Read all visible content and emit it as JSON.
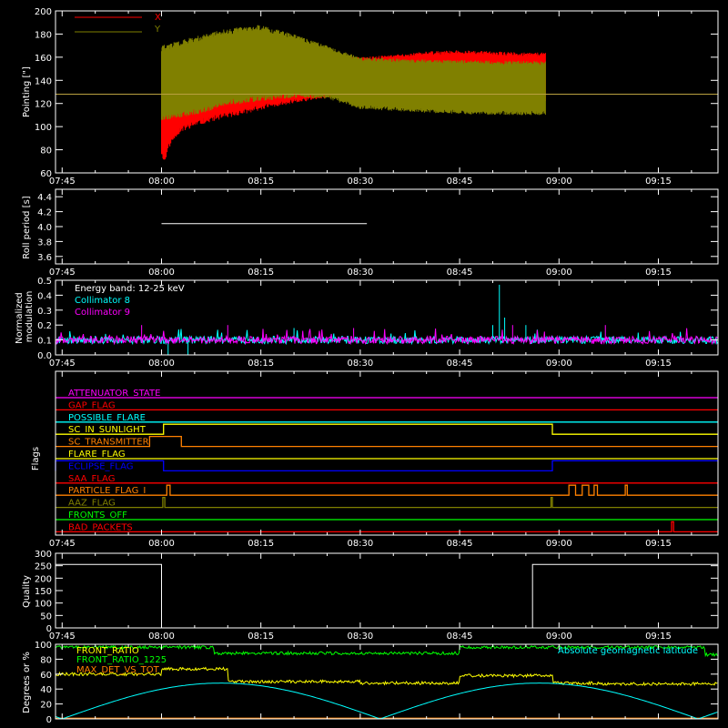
{
  "chart_data": [
    {
      "type": "line",
      "ylabel": "Pointing [\"]",
      "ylim": [
        60,
        200
      ],
      "yticks": [
        60,
        80,
        100,
        120,
        140,
        160,
        180,
        200
      ],
      "xticks": [
        "07:45",
        "08:00",
        "08:15",
        "08:30",
        "08:45",
        "09:00",
        "09:15"
      ],
      "legend_position": "top-left",
      "series": [
        {
          "name": "X",
          "color": "#ff0000",
          "x_min": [
            0,
            0.5,
            1,
            2,
            3,
            5,
            8,
            12,
            16,
            20,
            25,
            30,
            35,
            40,
            45,
            50,
            55,
            58
          ],
          "y_min": [
            75,
            68,
            80,
            90,
            95,
            100,
            105,
            110,
            116,
            120,
            125,
            125,
            124,
            124,
            123,
            123,
            122,
            122
          ],
          "x_max": [
            0,
            2,
            5,
            10,
            15,
            20,
            25,
            30,
            35,
            40,
            45,
            50,
            55,
            58
          ],
          "y_max": [
            150,
            155,
            165,
            170,
            170,
            165,
            162,
            160,
            162,
            165,
            166,
            165,
            164,
            164
          ]
        },
        {
          "name": "Y",
          "color": "#808000",
          "x_min": [
            0,
            5,
            10,
            15,
            20,
            25,
            30,
            40,
            50,
            58
          ],
          "y_min": [
            105,
            110,
            118,
            122,
            125,
            124,
            115,
            112,
            110,
            110
          ],
          "x_max": [
            0,
            5,
            10,
            15,
            20,
            25,
            30,
            40,
            50,
            58
          ],
          "y_max": [
            170,
            178,
            185,
            188,
            180,
            170,
            160,
            158,
            157,
            157
          ]
        }
      ],
      "reference_line": {
        "y": 128,
        "color": "#b8a040"
      }
    },
    {
      "type": "line",
      "ylabel": "Roll period [s]",
      "ylim": [
        3.5,
        4.5
      ],
      "yticks": [
        3.6,
        3.8,
        4.0,
        4.2,
        4.4
      ],
      "xticks": [
        "07:45",
        "08:00",
        "08:15",
        "08:30",
        "08:45",
        "09:00",
        "09:15"
      ],
      "series": [
        {
          "x": [
            0,
            31
          ],
          "y": [
            4.04,
            4.04
          ],
          "color": "#ffffff"
        }
      ]
    },
    {
      "type": "line",
      "ylabel": "Normalized modulation",
      "ylim": [
        0,
        0.5
      ],
      "yticks": [
        0.0,
        0.1,
        0.2,
        0.3,
        0.4,
        0.5
      ],
      "xticks": [
        "07:45",
        "08:00",
        "08:15",
        "08:30",
        "08:45",
        "09:00",
        "09:15"
      ],
      "annotation": "Energy band: 12-25 keV",
      "series": [
        {
          "name": "Collimator 8",
          "color": "#00ffff",
          "baseline": 0.1,
          "spikes": [
            {
              "x": 51,
              "y": 0.47
            },
            {
              "x": 51.8,
              "y": 0.25
            },
            {
              "x": 50,
              "y": 0.2
            },
            {
              "x": 20,
              "y": 0.18
            },
            {
              "x": 55,
              "y": 0.2
            }
          ],
          "dips": [
            {
              "x": 1,
              "y": 0.0
            },
            {
              "x": 4,
              "y": 0.0
            }
          ]
        },
        {
          "name": "Collimator 9",
          "color": "#ff00ff",
          "baseline": 0.1,
          "spikes": [
            {
              "x": -3,
              "y": 0.2
            },
            {
              "x": 10,
              "y": 0.2
            },
            {
              "x": 29,
              "y": 0.18
            },
            {
              "x": 53,
              "y": 0.2
            },
            {
              "x": 67,
              "y": 0.2
            }
          ]
        }
      ]
    },
    {
      "type": "line",
      "ylabel": "Flags",
      "xticks": [
        "07:45",
        "08:00",
        "08:15",
        "08:30",
        "08:45",
        "09:00",
        "09:15"
      ],
      "series": [
        {
          "name": "ATTENUATOR_STATE",
          "color": "#ff00ff",
          "high": []
        },
        {
          "name": "GAP_FLAG",
          "color": "#ff0000",
          "high": []
        },
        {
          "name": "POSSIBLE_FLARE",
          "color": "#00ffff",
          "high": []
        },
        {
          "name": "SC_IN_SUNLIGHT",
          "color": "#ffff00",
          "high": [
            [
              0.3,
              59
            ]
          ]
        },
        {
          "name": "SC_TRANSMITTER",
          "color": "#ff8000",
          "high": [
            [
              -1.8,
              3
            ]
          ]
        },
        {
          "name": "FLARE_FLAG",
          "color": "#ffff00",
          "high": []
        },
        {
          "name": "ECLIPSE_FLAG",
          "color": "#0000ff",
          "high": [
            [
              -99,
              0.3
            ],
            [
              59,
              99
            ]
          ]
        },
        {
          "name": "SAA_FLAG",
          "color": "#ff0000",
          "high": []
        },
        {
          "name": "PARTICLE_FLAG_I",
          "color": "#ff8000",
          "high": [
            [
              0.8,
              1.3
            ],
            [
              61.5,
              62.5
            ],
            [
              63.5,
              64.5
            ],
            [
              65.3,
              65.8
            ],
            [
              70,
              70.3
            ]
          ]
        },
        {
          "name": "AAZ_FLAG",
          "color": "#808000",
          "high": [
            [
              0.2,
              0.5
            ],
            [
              58.8,
              59
            ]
          ]
        },
        {
          "name": "FRONTS_OFF",
          "color": "#00ff00",
          "high": []
        },
        {
          "name": "BAD_PACKETS",
          "color": "#ff0000",
          "high": [
            [
              77,
              77.3
            ]
          ]
        }
      ]
    },
    {
      "type": "line",
      "ylabel": "Quality",
      "ylim": [
        0,
        300
      ],
      "yticks": [
        0,
        50,
        100,
        150,
        200,
        250,
        300
      ],
      "xticks": [
        "07:45",
        "08:00",
        "08:15",
        "08:30",
        "08:45",
        "09:00",
        "09:15"
      ],
      "series": [
        {
          "color": "#ffffff",
          "x": [
            -16,
            0,
            0,
            56,
            56,
            84
          ],
          "y": [
            255,
            255,
            0,
            0,
            255,
            255
          ]
        }
      ]
    },
    {
      "type": "line",
      "ylabel": "Degrees or %",
      "ylim": [
        0,
        100
      ],
      "yticks": [
        0,
        20,
        40,
        60,
        80,
        100
      ],
      "series": [
        {
          "name": "FRONT_RATIO",
          "color": "#ffff00"
        },
        {
          "name": "FRONT_RATIO_1225",
          "color": "#00ff00"
        },
        {
          "name": "MAX_DET_VS_TOT",
          "color": "#ff8000"
        },
        {
          "name": "Absolute geomagnetic latitude",
          "color": "#00ffff"
        }
      ]
    }
  ]
}
